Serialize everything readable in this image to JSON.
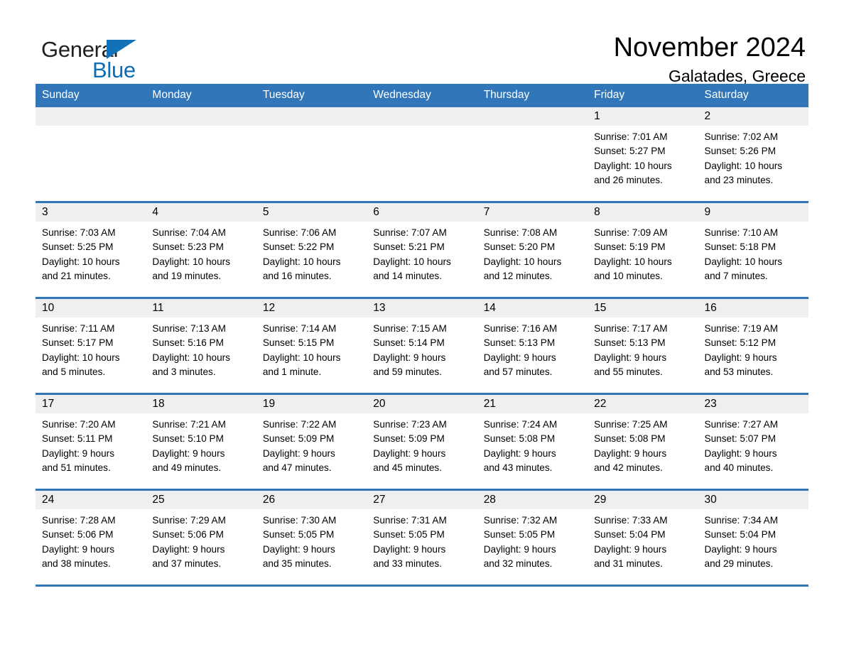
{
  "brand": {
    "name_part1": "General",
    "name_part2": "Blue",
    "triangle_color": "#1272b8",
    "blue_text_color": "#0b6cb7"
  },
  "header": {
    "month_title": "November 2024",
    "location": "Galatades, Greece"
  },
  "theme": {
    "header_row_bg": "#3176b8",
    "day_number_bg": "#efeff0",
    "cell_bg": "#ffffff",
    "text_color": "#000000"
  },
  "weekday_headers": [
    "Sunday",
    "Monday",
    "Tuesday",
    "Wednesday",
    "Thursday",
    "Friday",
    "Saturday"
  ],
  "weeks": [
    [
      {
        "day": "",
        "sunrise": "",
        "sunset": "",
        "daylight1": "",
        "daylight2": "",
        "empty": true
      },
      {
        "day": "",
        "sunrise": "",
        "sunset": "",
        "daylight1": "",
        "daylight2": "",
        "empty": true
      },
      {
        "day": "",
        "sunrise": "",
        "sunset": "",
        "daylight1": "",
        "daylight2": "",
        "empty": true
      },
      {
        "day": "",
        "sunrise": "",
        "sunset": "",
        "daylight1": "",
        "daylight2": "",
        "empty": true
      },
      {
        "day": "",
        "sunrise": "",
        "sunset": "",
        "daylight1": "",
        "daylight2": "",
        "empty": true
      },
      {
        "day": "1",
        "sunrise": "Sunrise: 7:01 AM",
        "sunset": "Sunset: 5:27 PM",
        "daylight1": "Daylight: 10 hours",
        "daylight2": "and 26 minutes.",
        "empty": false
      },
      {
        "day": "2",
        "sunrise": "Sunrise: 7:02 AM",
        "sunset": "Sunset: 5:26 PM",
        "daylight1": "Daylight: 10 hours",
        "daylight2": "and 23 minutes.",
        "empty": false
      }
    ],
    [
      {
        "day": "3",
        "sunrise": "Sunrise: 7:03 AM",
        "sunset": "Sunset: 5:25 PM",
        "daylight1": "Daylight: 10 hours",
        "daylight2": "and 21 minutes.",
        "empty": false
      },
      {
        "day": "4",
        "sunrise": "Sunrise: 7:04 AM",
        "sunset": "Sunset: 5:23 PM",
        "daylight1": "Daylight: 10 hours",
        "daylight2": "and 19 minutes.",
        "empty": false
      },
      {
        "day": "5",
        "sunrise": "Sunrise: 7:06 AM",
        "sunset": "Sunset: 5:22 PM",
        "daylight1": "Daylight: 10 hours",
        "daylight2": "and 16 minutes.",
        "empty": false
      },
      {
        "day": "6",
        "sunrise": "Sunrise: 7:07 AM",
        "sunset": "Sunset: 5:21 PM",
        "daylight1": "Daylight: 10 hours",
        "daylight2": "and 14 minutes.",
        "empty": false
      },
      {
        "day": "7",
        "sunrise": "Sunrise: 7:08 AM",
        "sunset": "Sunset: 5:20 PM",
        "daylight1": "Daylight: 10 hours",
        "daylight2": "and 12 minutes.",
        "empty": false
      },
      {
        "day": "8",
        "sunrise": "Sunrise: 7:09 AM",
        "sunset": "Sunset: 5:19 PM",
        "daylight1": "Daylight: 10 hours",
        "daylight2": "and 10 minutes.",
        "empty": false
      },
      {
        "day": "9",
        "sunrise": "Sunrise: 7:10 AM",
        "sunset": "Sunset: 5:18 PM",
        "daylight1": "Daylight: 10 hours",
        "daylight2": "and 7 minutes.",
        "empty": false
      }
    ],
    [
      {
        "day": "10",
        "sunrise": "Sunrise: 7:11 AM",
        "sunset": "Sunset: 5:17 PM",
        "daylight1": "Daylight: 10 hours",
        "daylight2": "and 5 minutes.",
        "empty": false
      },
      {
        "day": "11",
        "sunrise": "Sunrise: 7:13 AM",
        "sunset": "Sunset: 5:16 PM",
        "daylight1": "Daylight: 10 hours",
        "daylight2": "and 3 minutes.",
        "empty": false
      },
      {
        "day": "12",
        "sunrise": "Sunrise: 7:14 AM",
        "sunset": "Sunset: 5:15 PM",
        "daylight1": "Daylight: 10 hours",
        "daylight2": "and 1 minute.",
        "empty": false
      },
      {
        "day": "13",
        "sunrise": "Sunrise: 7:15 AM",
        "sunset": "Sunset: 5:14 PM",
        "daylight1": "Daylight: 9 hours",
        "daylight2": "and 59 minutes.",
        "empty": false
      },
      {
        "day": "14",
        "sunrise": "Sunrise: 7:16 AM",
        "sunset": "Sunset: 5:13 PM",
        "daylight1": "Daylight: 9 hours",
        "daylight2": "and 57 minutes.",
        "empty": false
      },
      {
        "day": "15",
        "sunrise": "Sunrise: 7:17 AM",
        "sunset": "Sunset: 5:13 PM",
        "daylight1": "Daylight: 9 hours",
        "daylight2": "and 55 minutes.",
        "empty": false
      },
      {
        "day": "16",
        "sunrise": "Sunrise: 7:19 AM",
        "sunset": "Sunset: 5:12 PM",
        "daylight1": "Daylight: 9 hours",
        "daylight2": "and 53 minutes.",
        "empty": false
      }
    ],
    [
      {
        "day": "17",
        "sunrise": "Sunrise: 7:20 AM",
        "sunset": "Sunset: 5:11 PM",
        "daylight1": "Daylight: 9 hours",
        "daylight2": "and 51 minutes.",
        "empty": false
      },
      {
        "day": "18",
        "sunrise": "Sunrise: 7:21 AM",
        "sunset": "Sunset: 5:10 PM",
        "daylight1": "Daylight: 9 hours",
        "daylight2": "and 49 minutes.",
        "empty": false
      },
      {
        "day": "19",
        "sunrise": "Sunrise: 7:22 AM",
        "sunset": "Sunset: 5:09 PM",
        "daylight1": "Daylight: 9 hours",
        "daylight2": "and 47 minutes.",
        "empty": false
      },
      {
        "day": "20",
        "sunrise": "Sunrise: 7:23 AM",
        "sunset": "Sunset: 5:09 PM",
        "daylight1": "Daylight: 9 hours",
        "daylight2": "and 45 minutes.",
        "empty": false
      },
      {
        "day": "21",
        "sunrise": "Sunrise: 7:24 AM",
        "sunset": "Sunset: 5:08 PM",
        "daylight1": "Daylight: 9 hours",
        "daylight2": "and 43 minutes.",
        "empty": false
      },
      {
        "day": "22",
        "sunrise": "Sunrise: 7:25 AM",
        "sunset": "Sunset: 5:08 PM",
        "daylight1": "Daylight: 9 hours",
        "daylight2": "and 42 minutes.",
        "empty": false
      },
      {
        "day": "23",
        "sunrise": "Sunrise: 7:27 AM",
        "sunset": "Sunset: 5:07 PM",
        "daylight1": "Daylight: 9 hours",
        "daylight2": "and 40 minutes.",
        "empty": false
      }
    ],
    [
      {
        "day": "24",
        "sunrise": "Sunrise: 7:28 AM",
        "sunset": "Sunset: 5:06 PM",
        "daylight1": "Daylight: 9 hours",
        "daylight2": "and 38 minutes.",
        "empty": false
      },
      {
        "day": "25",
        "sunrise": "Sunrise: 7:29 AM",
        "sunset": "Sunset: 5:06 PM",
        "daylight1": "Daylight: 9 hours",
        "daylight2": "and 37 minutes.",
        "empty": false
      },
      {
        "day": "26",
        "sunrise": "Sunrise: 7:30 AM",
        "sunset": "Sunset: 5:05 PM",
        "daylight1": "Daylight: 9 hours",
        "daylight2": "and 35 minutes.",
        "empty": false
      },
      {
        "day": "27",
        "sunrise": "Sunrise: 7:31 AM",
        "sunset": "Sunset: 5:05 PM",
        "daylight1": "Daylight: 9 hours",
        "daylight2": "and 33 minutes.",
        "empty": false
      },
      {
        "day": "28",
        "sunrise": "Sunrise: 7:32 AM",
        "sunset": "Sunset: 5:05 PM",
        "daylight1": "Daylight: 9 hours",
        "daylight2": "and 32 minutes.",
        "empty": false
      },
      {
        "day": "29",
        "sunrise": "Sunrise: 7:33 AM",
        "sunset": "Sunset: 5:04 PM",
        "daylight1": "Daylight: 9 hours",
        "daylight2": "and 31 minutes.",
        "empty": false
      },
      {
        "day": "30",
        "sunrise": "Sunrise: 7:34 AM",
        "sunset": "Sunset: 5:04 PM",
        "daylight1": "Daylight: 9 hours",
        "daylight2": "and 29 minutes.",
        "empty": false
      }
    ]
  ]
}
